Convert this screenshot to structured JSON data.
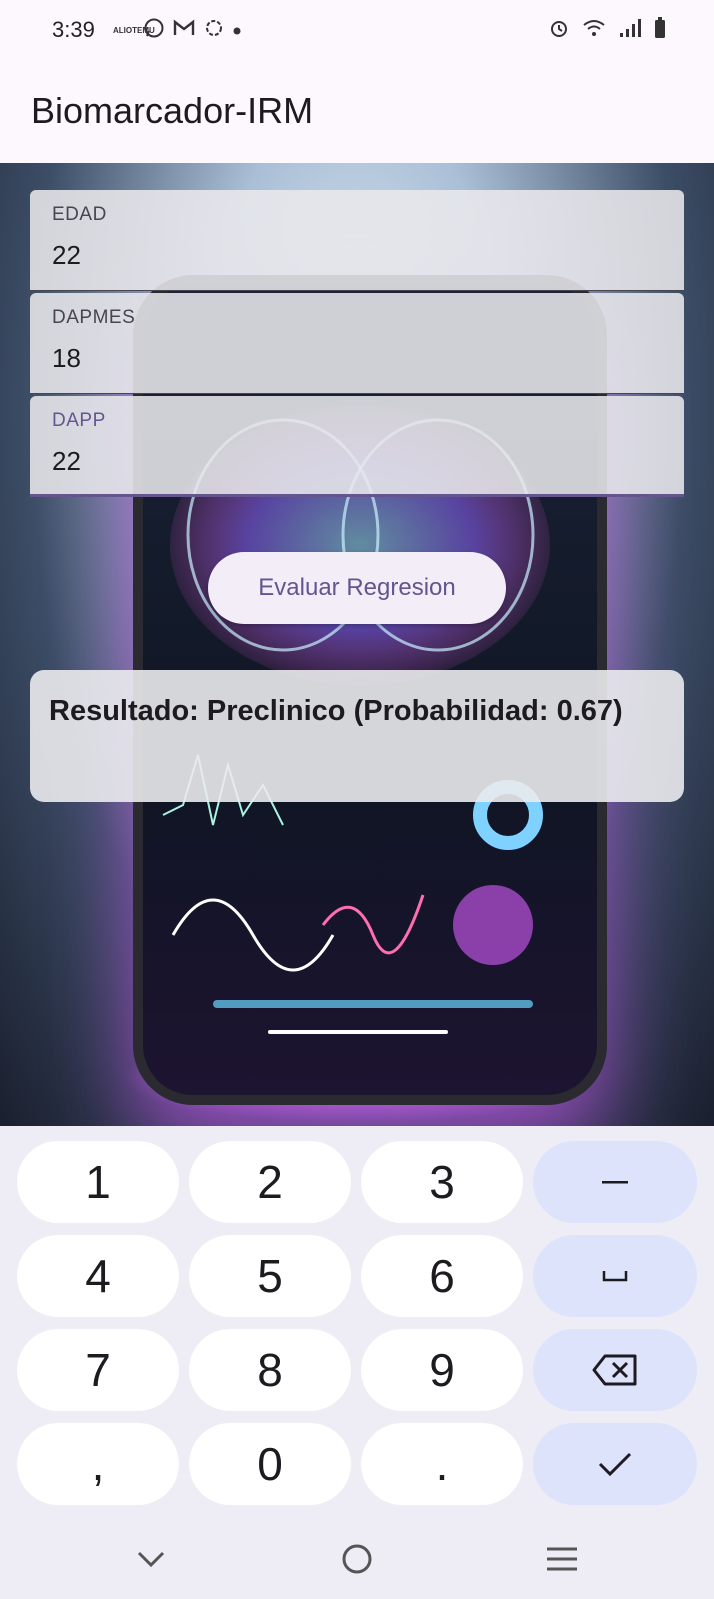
{
  "status_bar": {
    "time": "3:39",
    "notification_icons": [
      "temu-icon",
      "whatsapp-icon",
      "gmail-icon",
      "chatgpt-icon",
      "dot-icon"
    ],
    "temu_badge": "ALIOTEMU",
    "system_icons": [
      "alarm-icon",
      "wifi-icon",
      "signal-icon",
      "battery-icon"
    ]
  },
  "app_bar": {
    "title": "Biomarcador-IRM"
  },
  "form": {
    "fields": [
      {
        "label": "EDAD",
        "value": "22"
      },
      {
        "label": "DAPMES",
        "value": "18"
      },
      {
        "label": "DAPP",
        "value": "22",
        "focused": true
      }
    ],
    "evaluate_button": "Evaluar Regresion"
  },
  "result": {
    "text": "Resultado: Preclinico (Probabilidad: 0.67)"
  },
  "keyboard": {
    "rows": [
      [
        "1",
        "2",
        "3",
        "−"
      ],
      [
        "4",
        "5",
        "6",
        "␣"
      ],
      [
        "7",
        "8",
        "9",
        "⌫"
      ],
      [
        ",",
        "0",
        ".",
        "✓"
      ]
    ]
  },
  "nav_bar": {
    "buttons": [
      "back-chevron-icon",
      "home-circle-icon",
      "recents-menu-icon"
    ]
  },
  "colors": {
    "accent": "#65558f",
    "surface": "#fdf7fe",
    "fn_key": "#dde3fb"
  }
}
